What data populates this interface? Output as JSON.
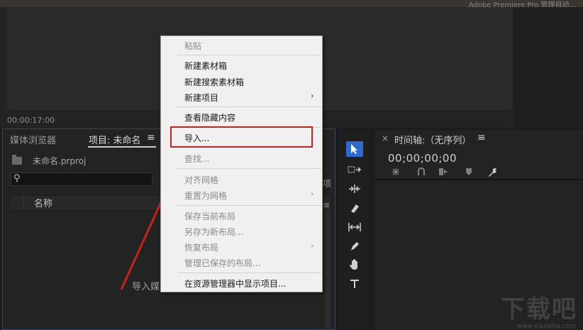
{
  "top_strip": {
    "text": "Adobe Premiere Pro 管理自动..."
  },
  "monitor": {
    "timecode": "00:00:17:00"
  },
  "project_panel": {
    "tab_media": "媒体浏览器",
    "tab_project": "项目: 未命名",
    "tab_menu_glyph": "≡",
    "file_name": "未命名.prproj",
    "search_glyph": "⚲",
    "column_name": "名称",
    "import_hint": "导入媒",
    "side_chars": [
      "项",
      "≡"
    ]
  },
  "timeline": {
    "close_glyph": "×",
    "title": "时间轴:（无序列）",
    "menu_glyph": "≡",
    "timecode": "00;00;00;00"
  },
  "context_menu": {
    "items": {
      "paste": "粘贴",
      "new_bin": "新建素材箱",
      "new_search_bin": "新建搜索素材箱",
      "new_item": "新建项目",
      "view_hidden": "查看隐藏内容",
      "import": "导入...",
      "find": "查找...",
      "align_grid": "对齐网格",
      "reset_grid": "重置为网格",
      "save_layout": "保存当前布局",
      "save_as_layout": "另存为新布局...",
      "restore_layout": "恢复布局",
      "manage_layouts": "管理已保存的布局...",
      "reveal_explorer": "在资源管理器中显示项目..."
    },
    "submenu_glyph": "›"
  },
  "colors": {
    "highlight": "#c8201f",
    "accent": "#2d6bd1"
  },
  "watermark": {
    "text": "下载吧",
    "url": "www.xiazaiba.com"
  }
}
